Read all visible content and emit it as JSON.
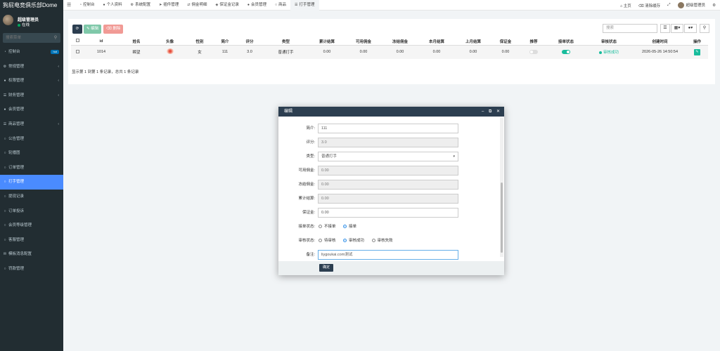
{
  "app": {
    "title": "狗屁电竞俱乐部Dome"
  },
  "user": {
    "name": "超级管理员",
    "status": "在线"
  },
  "sidebar": {
    "search_placeholder": "搜索菜单",
    "items": [
      {
        "label": "控制台",
        "icon": "dashboard-icon",
        "badge": "hot"
      },
      {
        "label": "常规管理",
        "icon": "cog-icon",
        "has_children": true
      },
      {
        "label": "权限管理",
        "icon": "users-icon",
        "has_children": true
      },
      {
        "label": "财务管理",
        "icon": "list-icon",
        "has_children": true
      },
      {
        "label": "会员管理",
        "icon": "user-icon"
      },
      {
        "label": "商品管理",
        "icon": "list-icon",
        "has_children": true
      },
      {
        "label": "公告管理",
        "icon": "circle-icon"
      },
      {
        "label": "轮播图",
        "icon": "circle-icon"
      },
      {
        "label": "订单管理",
        "icon": "circle-icon"
      },
      {
        "label": "打手管理",
        "icon": "circle-icon",
        "active": true
      },
      {
        "label": "提现记录",
        "icon": "circle-icon"
      },
      {
        "label": "订单投诉",
        "icon": "circle-icon"
      },
      {
        "label": "会员等级管理",
        "icon": "circle-icon"
      },
      {
        "label": "客服管理",
        "icon": "circle-icon"
      },
      {
        "label": "模板消息配置",
        "icon": "envelope-icon"
      },
      {
        "label": "罚款管理",
        "icon": "circle-icon"
      }
    ]
  },
  "topbar": {
    "tabs": [
      {
        "label": "控制台",
        "icon": "dashboard-icon"
      },
      {
        "label": "个人资料",
        "icon": "user-icon"
      },
      {
        "label": "系统配置",
        "icon": "cog-icon"
      },
      {
        "label": "插件管理",
        "icon": "rocket-icon"
      },
      {
        "label": "佣金明细",
        "icon": "exchange-icon"
      },
      {
        "label": "保证金记录",
        "icon": "shield-icon"
      },
      {
        "label": "会员管理",
        "icon": "user-icon"
      },
      {
        "label": "商品",
        "icon": "circle-icon"
      },
      {
        "label": "打手管理",
        "icon": "list-icon",
        "active": true
      }
    ],
    "right": {
      "home": "主页",
      "clear_cache": "清除缓存",
      "admin": "超级管理员"
    }
  },
  "toolbar": {
    "edit": "编辑",
    "delete": "删除",
    "search_placeholder": "搜索"
  },
  "table": {
    "columns": [
      "id",
      "姓名",
      "头像",
      "性别",
      "简介",
      "评分",
      "类型",
      "累计结算",
      "可用佣金",
      "冻结佣金",
      "本月结算",
      "上月结算",
      "保证金",
      "推荐",
      "接单状态",
      "审核状态",
      "创建时间",
      "操作"
    ],
    "rows": [
      {
        "id": "1014",
        "name": "瞬望",
        "gender": "女",
        "intro": "111",
        "score": "3.0",
        "type": "普通打手",
        "total_settle": "0.00",
        "available": "0.00",
        "frozen": "0.00",
        "month_settle": "0.00",
        "last_month_settle": "0.00",
        "deposit": "0.00",
        "recommend": false,
        "accepting": true,
        "audit_status": "审核成功",
        "created": "2026-05-26 14:50:54"
      }
    ],
    "pager": "显示第 1 到第 1 条记录，总共 1 条记录"
  },
  "dialog": {
    "title": "编辑",
    "fields": {
      "intro": {
        "label": "简介:",
        "value": "111"
      },
      "score": {
        "label": "评分:",
        "value": "3.0"
      },
      "type": {
        "label": "类型:",
        "value": "普通打手"
      },
      "available": {
        "label": "可用佣金:",
        "value": "0.00"
      },
      "frozen": {
        "label": "冻结佣金:",
        "value": "0.00"
      },
      "total_settle": {
        "label": "累计结算:",
        "value": "0.00"
      },
      "deposit": {
        "label": "保证金:",
        "value": "0.00"
      },
      "accept_status": {
        "label": "接单状态:",
        "options": [
          "不接单",
          "接单"
        ],
        "selected": 1
      },
      "audit_status": {
        "label": "审核状态:",
        "options": [
          "待审核",
          "审核成功",
          "审核失败"
        ],
        "selected": 1
      },
      "remark": {
        "label": "备注:",
        "value": "liygoukai.com测试"
      }
    },
    "ok": "确定"
  },
  "colors": {
    "sidebar_bg": "#222d32",
    "active": "#4a8bff",
    "accent": "#18bc9c",
    "header_dark": "#2c3e50"
  }
}
